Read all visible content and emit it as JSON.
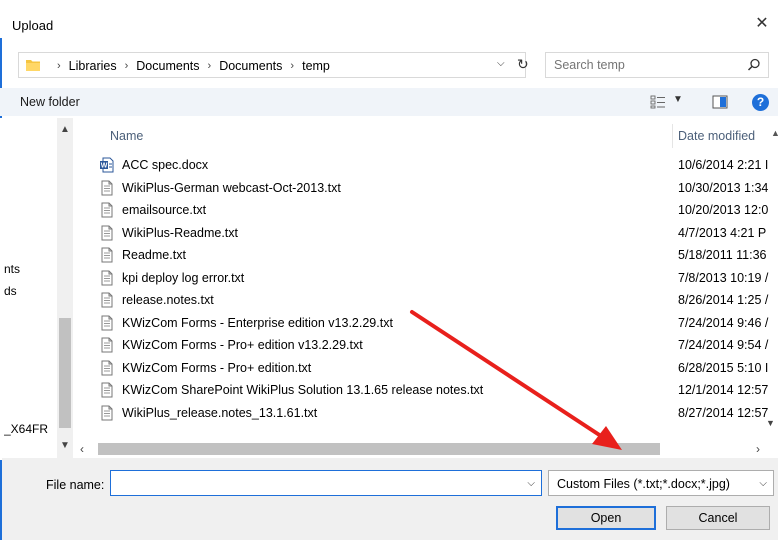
{
  "window": {
    "title": "Upload",
    "close_label": "✕"
  },
  "address": {
    "crumbs": [
      "Libraries",
      "Documents",
      "Documents",
      "temp"
    ],
    "separator": "›",
    "refresh_glyph": "↻",
    "dropdown_glyph": "⌵"
  },
  "search": {
    "placeholder": "Search temp"
  },
  "toolbar": {
    "new_folder_label": "New folder",
    "help_glyph": "?"
  },
  "nav": {
    "items": [
      "nts",
      "ds",
      "_X64FR"
    ]
  },
  "list": {
    "headers": {
      "name": "Name",
      "date": "Date modified"
    },
    "files": [
      {
        "name": "ACC spec.docx",
        "date": "10/6/2014 2:21 I",
        "type": "docx"
      },
      {
        "name": "WikiPlus-German webcast-Oct-2013.txt",
        "date": "10/30/2013 1:34",
        "type": "txt"
      },
      {
        "name": "emailsource.txt",
        "date": "10/20/2013 12:0",
        "type": "txt"
      },
      {
        "name": "WikiPlus-Readme.txt",
        "date": "4/7/2013 4:21 P",
        "type": "txt"
      },
      {
        "name": "Readme.txt",
        "date": "5/18/2011 11:36",
        "type": "txt"
      },
      {
        "name": "kpi deploy log error.txt",
        "date": "7/8/2013 10:19 /",
        "type": "txt"
      },
      {
        "name": "release.notes.txt",
        "date": "8/26/2014 1:25 /",
        "type": "txt"
      },
      {
        "name": "KWizCom Forms - Enterprise edition v13.2.29.txt",
        "date": "7/24/2014 9:46 /",
        "type": "txt"
      },
      {
        "name": "KWizCom Forms -  Pro+ edition v13.2.29.txt",
        "date": "7/24/2014 9:54 /",
        "type": "txt"
      },
      {
        "name": "KWizCom Forms -  Pro+ edition.txt",
        "date": "6/28/2015 5:10 I",
        "type": "txt"
      },
      {
        "name": "KWizCom SharePoint WikiPlus Solution 13.1.65 release notes.txt",
        "date": "12/1/2014 12:57",
        "type": "txt"
      },
      {
        "name": "WikiPlus_release.notes_13.1.61.txt",
        "date": "8/27/2014 12:57",
        "type": "txt"
      }
    ]
  },
  "bottom": {
    "file_name_label": "File name:",
    "file_name_value": "",
    "filter_label": "Custom Files (*.txt;*.docx;*.jpg)",
    "open_label": "Open",
    "cancel_label": "Cancel"
  },
  "colors": {
    "accent": "#1e6fd9",
    "annotation_arrow": "#e8201c"
  }
}
